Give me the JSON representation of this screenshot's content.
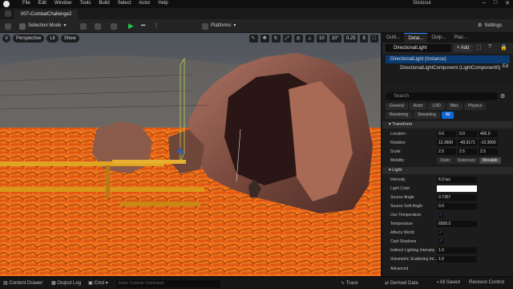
{
  "menu": [
    "File",
    "Edit",
    "Window",
    "Tools",
    "Build",
    "Select",
    "Actor",
    "Help"
  ],
  "project_name": "Stickiout",
  "tab_title": "007-CombatChallenge2",
  "toolbar": {
    "selection_mode": "Selection Mode",
    "platforms": "Platforms",
    "settings": "Settings"
  },
  "viewport": {
    "perspective": "Perspective",
    "lit": "Lit",
    "show": "Show",
    "grid": "10",
    "angle": "10°",
    "scale": "0.25",
    "camera_speed": "8"
  },
  "panel": {
    "tabs": [
      "Outli...",
      "Detai...",
      "Outp...",
      "Plac..."
    ],
    "actor_name": "DirectionalLight",
    "add_label": "Add",
    "instance": "DirectionalLight (Instance)",
    "component": "DirectionalLightComponent (LightComponent0)",
    "edit_label": "Ed",
    "search_placeholder": "Search",
    "filters": [
      "General",
      "Actor",
      "LOD",
      "Misc",
      "Physics",
      "Rendering",
      "Streaming",
      "All"
    ],
    "active_filter": "All",
    "transform_title": "Transform",
    "location_label": "Location",
    "location": [
      "0.0",
      "0.0",
      "400.0"
    ],
    "rotation_label": "Rotation",
    "rotation": [
      "12.3600",
      "-49.5171",
      "-10.3000"
    ],
    "scale_label": "Scale",
    "scale": [
      "2.5",
      "2.5",
      "2.5"
    ],
    "mobility_label": "Mobility",
    "mobility": [
      "Static",
      "Stationary",
      "Movable"
    ],
    "light_title": "Light",
    "intensity_label": "Intensity",
    "intensity": "6.0 lux",
    "light_color_label": "Light Color",
    "source_angle_label": "Source Angle",
    "source_angle": "0.7357",
    "soft_angle_label": "Source Soft Angle",
    "soft_angle": "0.0",
    "use_temp_label": "Use Temperature",
    "temperature_label": "Temperature",
    "temperature": "6500.0",
    "affects_world_label": "Affects World",
    "cast_shadows_label": "Cast Shadows",
    "indirect_label": "Indirect Lighting Intensity",
    "indirect": "1.0",
    "volumetric_label": "Volumetric Scattering Int...",
    "volumetric": "1.0",
    "advanced_label": "Advanced"
  },
  "status": {
    "content_drawer": "Content Drawer",
    "output_log": "Output Log",
    "cmd": "Cmd",
    "console_placeholder": "Enter Console Command",
    "trace": "Trace",
    "derived_data": "Derived Data",
    "all_saved": "All Saved",
    "revision_control": "Revision Control"
  }
}
